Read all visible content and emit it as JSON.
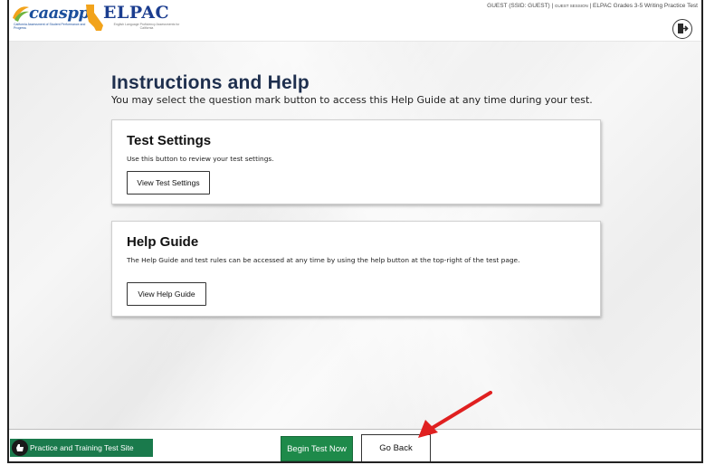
{
  "header": {
    "caaspp_logo_text": "caaspp",
    "caaspp_logo_subtitle": "California Assessment of Student Performance and Progress",
    "elpac_logo_text": "ELPAC",
    "elpac_logo_subtitle": "English Language Proficiency Assessments for California",
    "user_info": "GUEST (SSID: GUEST) |",
    "session_info": "GUEST SESSION",
    "test_name": "| ELPAC Grades 3-5 Writing Practice Test",
    "exit_icon": "exit-door-icon"
  },
  "main": {
    "title": "Instructions and Help",
    "description": "You may select the question mark button to access this Help Guide at any time during your test.",
    "cards": [
      {
        "title": "Test Settings",
        "description": "Use this button to review your test settings.",
        "button_label": "View Test Settings"
      },
      {
        "title": "Help Guide",
        "description": "The Help Guide and test rules can be accessed at any time by using the help button at the top-right of the test page.",
        "button_label": "View Help Guide"
      }
    ]
  },
  "footer": {
    "site_label": "Practice and Training Test Site",
    "begin_label": "Begin Test Now",
    "back_label": "Go Back"
  },
  "colors": {
    "primary_green": "#1e8a4a",
    "site_green": "#1a7a4c",
    "title_navy": "#1e2f4e",
    "annotation_red": "#e02020"
  }
}
